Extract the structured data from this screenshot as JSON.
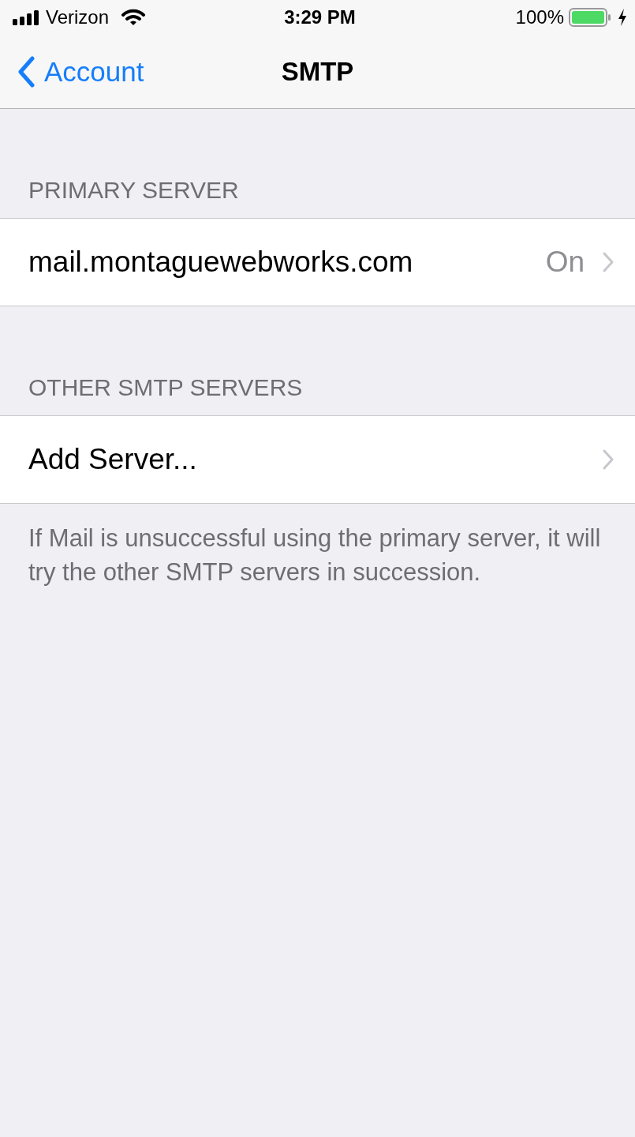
{
  "status_bar": {
    "carrier": "Verizon",
    "time": "3:29 PM",
    "battery": "100%"
  },
  "nav_bar": {
    "back": "Account",
    "title": "SMTP"
  },
  "sections": [
    {
      "header": "PRIMARY SERVER",
      "rows": [
        {
          "label": "mail.montaguewebworks.com",
          "value": "On"
        }
      ]
    },
    {
      "header": "OTHER SMTP SERVERS",
      "rows": [
        {
          "label": "Add Server..."
        }
      ],
      "footer": "If Mail is unsuccessful using the primary server, it will try the other SMTP servers in succession."
    }
  ]
}
